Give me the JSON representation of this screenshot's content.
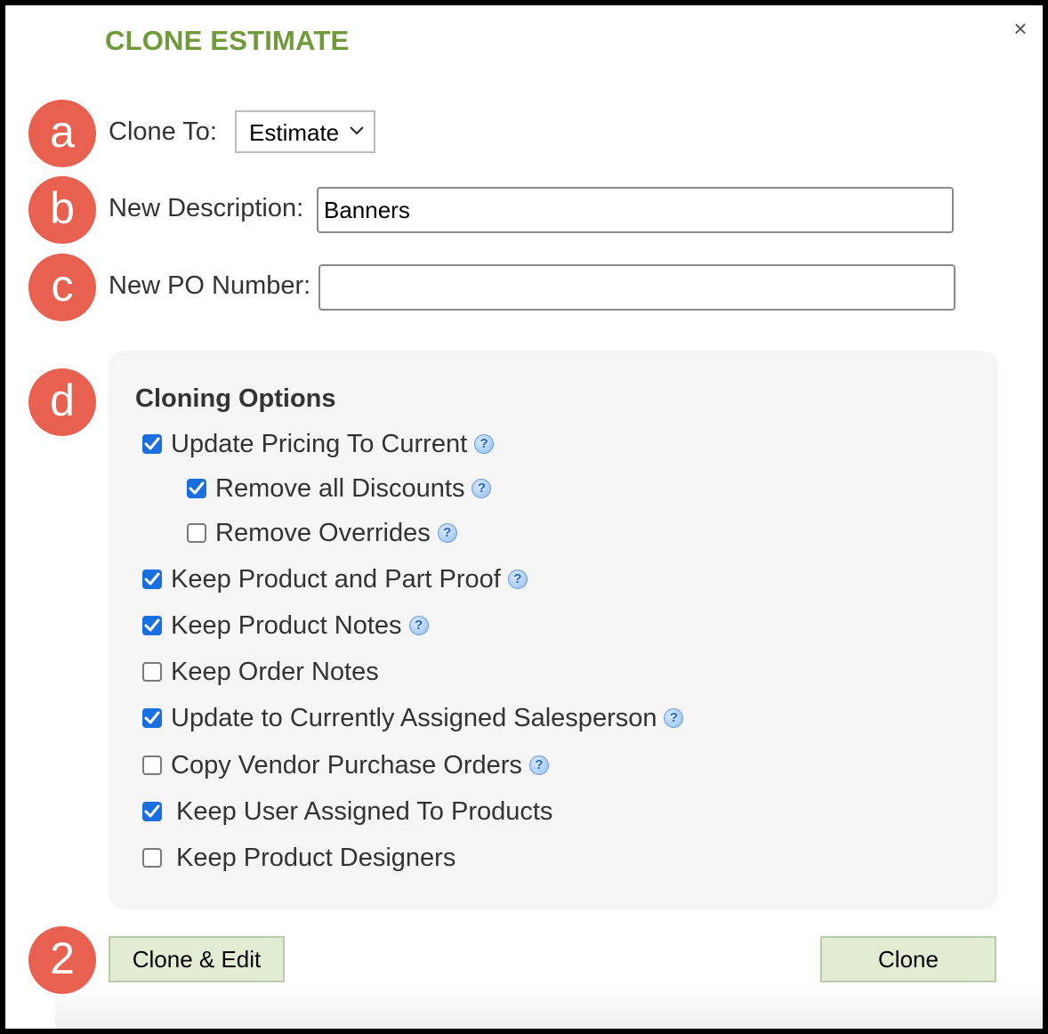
{
  "dialog": {
    "title": "CLONE ESTIMATE",
    "close_symbol": "×"
  },
  "markers": {
    "a": "a",
    "b": "b",
    "c": "c",
    "d": "d",
    "submit": "2",
    "color": "#e8604f"
  },
  "form": {
    "clone_to": {
      "label": "Clone To:",
      "selected": "Estimate"
    },
    "description": {
      "label": "New Description:",
      "value": "Banners"
    },
    "po_number": {
      "label": "New PO Number:",
      "value": ""
    }
  },
  "options": {
    "title": "Cloning Options",
    "items": [
      {
        "label": "Update Pricing To Current",
        "checked": true,
        "help": true,
        "help_icon": "help-icon"
      },
      {
        "label": "Remove all Discounts",
        "checked": true,
        "help": true,
        "help_icon": "help-icon"
      },
      {
        "label": "Remove Overrides",
        "checked": false,
        "help": true,
        "help_icon": "help-icon"
      },
      {
        "label": "Keep Product and Part Proof",
        "checked": true,
        "help": true,
        "help_icon": "help-icon"
      },
      {
        "label": "Keep Product Notes",
        "checked": true,
        "help": true,
        "help_icon": "help-icon"
      },
      {
        "label": "Keep Order Notes",
        "checked": false,
        "help": false
      },
      {
        "label": "Update to Currently Assigned Salesperson",
        "checked": true,
        "help": true,
        "help_icon": "help-icon"
      },
      {
        "label": "Copy Vendor Purchase Orders",
        "checked": false,
        "help": true,
        "help_icon": "help-icon"
      },
      {
        "label": "Keep User Assigned To Products",
        "checked": true,
        "help": false
      },
      {
        "label": "Keep Product Designers",
        "checked": false,
        "help": false
      }
    ]
  },
  "buttons": {
    "clone_edit": "Clone & Edit",
    "clone": "Clone"
  },
  "colors": {
    "title": "#6e9a3a",
    "checkbox_on": "#1a6fe0",
    "button_bg": "#e2ecd3",
    "panel_bg": "#f5f5f5"
  }
}
